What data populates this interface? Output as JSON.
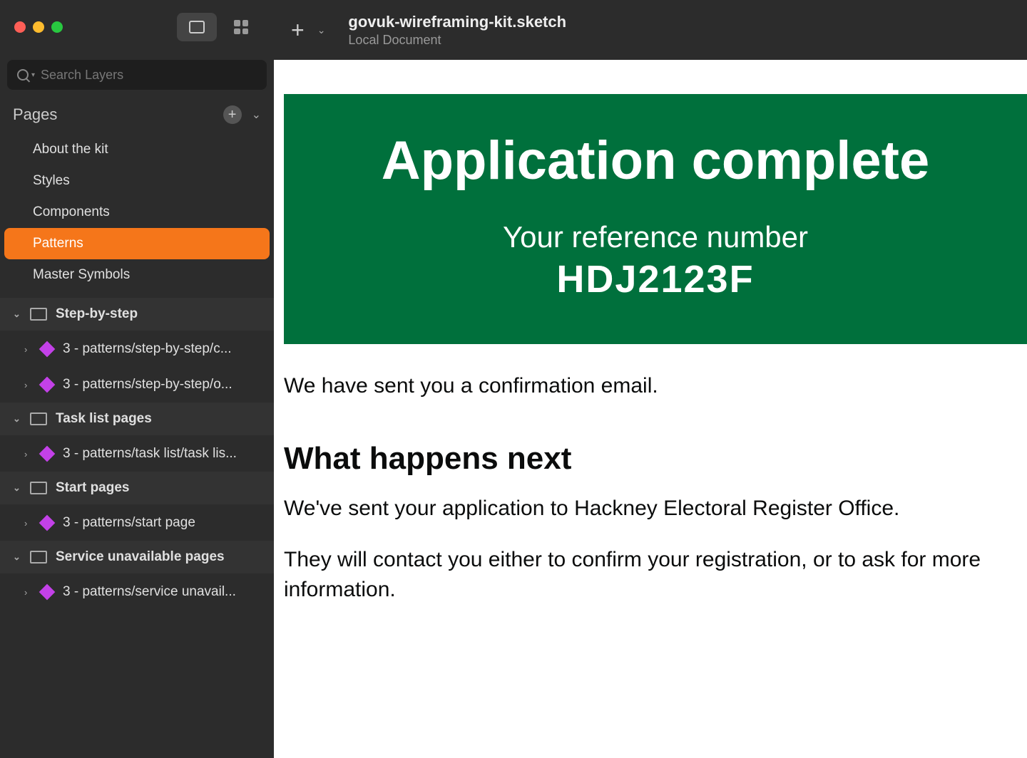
{
  "window": {
    "title": "govuk-wireframing-kit.sketch",
    "subtitle": "Local Document"
  },
  "search": {
    "placeholder": "Search Layers"
  },
  "pages": {
    "header": "Pages",
    "items": [
      {
        "label": "About the kit",
        "selected": false
      },
      {
        "label": "Styles",
        "selected": false
      },
      {
        "label": "Components",
        "selected": false
      },
      {
        "label": "Patterns",
        "selected": true
      },
      {
        "label": "Master Symbols",
        "selected": false
      }
    ]
  },
  "layers": {
    "groups": [
      {
        "label": "Step-by-step",
        "items": [
          {
            "label": "3 - patterns/step-by-step/c..."
          },
          {
            "label": "3 - patterns/step-by-step/o..."
          }
        ]
      },
      {
        "label": "Task list pages",
        "items": [
          {
            "label": "3 - patterns/task list/task lis..."
          }
        ]
      },
      {
        "label": "Start pages",
        "items": [
          {
            "label": "3 - patterns/start page"
          }
        ]
      },
      {
        "label": "Service unavailable pages",
        "items": [
          {
            "label": "3 - patterns/service unavail..."
          }
        ]
      }
    ]
  },
  "canvas": {
    "panel_title": "Application complete",
    "ref_label": "Your reference number",
    "ref_number": "HDJ2123F",
    "confirm_text": "We have sent you a confirmation email.",
    "next_heading": "What happens next",
    "para1": "We've sent your application to Hackney Electoral Register Office.",
    "para2": "They will contact you either to confirm your registration, or to ask for more information."
  },
  "colors": {
    "accent_orange": "#f5761a",
    "govuk_green": "#00703c",
    "symbol_purple": "#c341e8"
  }
}
